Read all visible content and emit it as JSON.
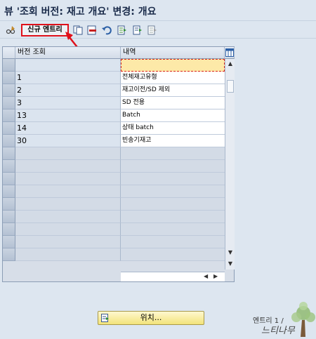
{
  "title": "뷰 '조회 버전: 재고 개요' 변경: 개요",
  "toolbar": {
    "new_entry_label": "신규 엔트리",
    "icons": [
      "glasses-edit-icon",
      "copy-icon",
      "delete-icon",
      "undo-icon",
      "select-all-icon",
      "select-block-icon",
      "deselect-all-icon"
    ]
  },
  "table": {
    "columns": [
      "버전 조회",
      "내역"
    ],
    "rows": [
      {
        "version": "",
        "description": ""
      },
      {
        "version": "1",
        "description": "전체재고유형"
      },
      {
        "version": "2",
        "description": "재고이전/SD 제외"
      },
      {
        "version": "3",
        "description": "SD 전용"
      },
      {
        "version": "13",
        "description": "Batch"
      },
      {
        "version": "14",
        "description": "상태 batch"
      },
      {
        "version": "30",
        "description": "빈송기재고"
      }
    ],
    "empty_rows": 9
  },
  "position_button_label": "위치...",
  "watermark": {
    "line1": "엔트리 1 /",
    "line2": "느티나무"
  },
  "colors": {
    "highlight": "#e0101a",
    "input_cell": "#fde9a8"
  }
}
